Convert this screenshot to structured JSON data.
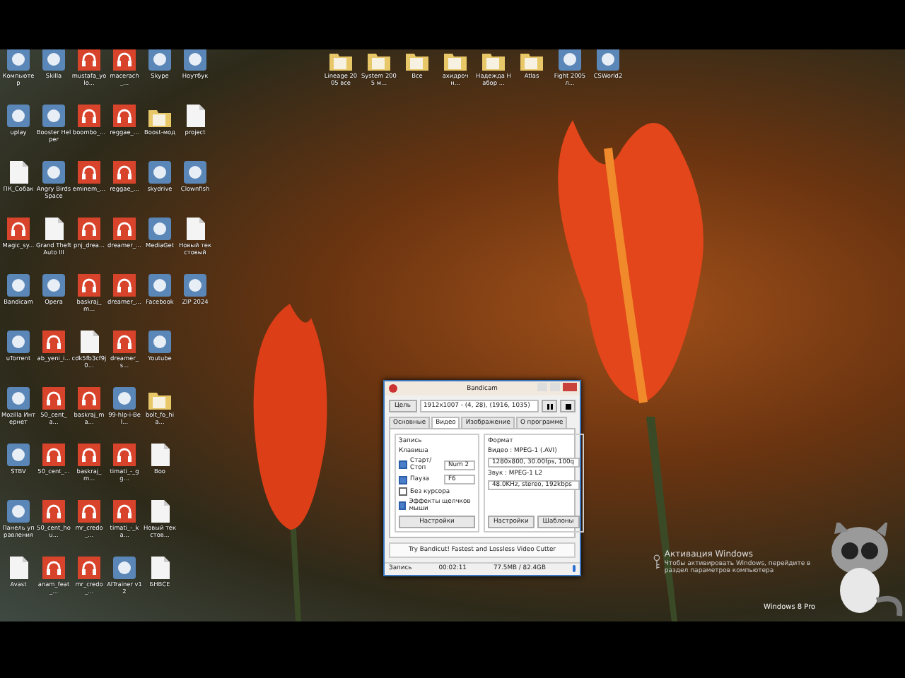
{
  "desktop_columns": [
    {
      "icons": [
        {
          "label": "Компьютер",
          "kind": "app"
        },
        {
          "label": "uplay",
          "kind": "app"
        },
        {
          "label": "ПК_Собак",
          "kind": "file"
        },
        {
          "label": "Magic_sy...",
          "kind": "audio"
        },
        {
          "label": "Bandicam",
          "kind": "app"
        },
        {
          "label": "uTorrent",
          "kind": "app"
        },
        {
          "label": "Mozilla Интернет",
          "kind": "app"
        },
        {
          "label": "STBV",
          "kind": "app"
        },
        {
          "label": "Панель управления",
          "kind": "app"
        },
        {
          "label": "Avast",
          "kind": "file"
        }
      ]
    },
    {
      "icons": [
        {
          "label": "Skilla",
          "kind": "app"
        },
        {
          "label": "Booster Helper",
          "kind": "app"
        },
        {
          "label": "Angry Birds Space",
          "kind": "app"
        },
        {
          "label": "Grand Theft Auto III",
          "kind": "file"
        },
        {
          "label": "Opera",
          "kind": "app"
        },
        {
          "label": "ab_yeni_i...",
          "kind": "audio"
        },
        {
          "label": "50_cent_a...",
          "kind": "audio"
        },
        {
          "label": "50_cent_...",
          "kind": "audio"
        },
        {
          "label": "50_cent_hou...",
          "kind": "audio"
        },
        {
          "label": "anam_feat_...",
          "kind": "audio"
        }
      ]
    },
    {
      "icons": [
        {
          "label": "mustafa_yolo...",
          "kind": "audio"
        },
        {
          "label": "boombo_...",
          "kind": "audio"
        },
        {
          "label": "eminem_...",
          "kind": "audio"
        },
        {
          "label": "pnj_drea...",
          "kind": "audio"
        },
        {
          "label": "baskraj_m...",
          "kind": "audio"
        },
        {
          "label": "cdk5fb3cf9j0...",
          "kind": "file"
        },
        {
          "label": "baskraj_ma...",
          "kind": "audio"
        },
        {
          "label": "baskraj_m...",
          "kind": "audio"
        },
        {
          "label": "mr_credo_...",
          "kind": "audio"
        },
        {
          "label": "mr_credo_...",
          "kind": "audio"
        }
      ]
    },
    {
      "icons": [
        {
          "label": "macerach_...",
          "kind": "audio"
        },
        {
          "label": "reggae_...",
          "kind": "audio"
        },
        {
          "label": "reggae_...",
          "kind": "audio"
        },
        {
          "label": "dreamer_...",
          "kind": "audio"
        },
        {
          "label": "dreamer_...",
          "kind": "audio"
        },
        {
          "label": "dreamer_s...",
          "kind": "audio"
        },
        {
          "label": "99-hlp-i-Bel...",
          "kind": "app"
        },
        {
          "label": "timati_-_gg...",
          "kind": "audio"
        },
        {
          "label": "timati_-_ka...",
          "kind": "audio"
        },
        {
          "label": "AlTrainer v12",
          "kind": "app"
        }
      ]
    },
    {
      "icons": [
        {
          "label": "Skype",
          "kind": "app"
        },
        {
          "label": "Boost-мод",
          "kind": "folder"
        },
        {
          "label": "skydrive",
          "kind": "app"
        },
        {
          "label": "MediaGet",
          "kind": "app"
        },
        {
          "label": "Facebook",
          "kind": "app"
        },
        {
          "label": "Youtube",
          "kind": "app"
        },
        {
          "label": "bolt_fo_hia...",
          "kind": "folder"
        },
        {
          "label": "Boo",
          "kind": "file"
        },
        {
          "label": "Новый текстов...",
          "kind": "file"
        },
        {
          "label": "БНВСЕ",
          "kind": "file"
        }
      ]
    },
    {
      "icons": [
        {
          "label": "Ноутбук",
          "kind": "app"
        },
        {
          "label": "project",
          "kind": "file"
        },
        {
          "label": "Clownfish",
          "kind": "app"
        },
        {
          "label": "Новый текстовый",
          "kind": "file"
        },
        {
          "label": "ZIP 2024",
          "kind": "app"
        }
      ]
    }
  ],
  "top_icons": [
    {
      "label": "Lineage 2005 все",
      "kind": "folder"
    },
    {
      "label": "System 2005 м...",
      "kind": "folder"
    },
    {
      "label": "Все",
      "kind": "folder"
    },
    {
      "label": "ахидрочн...",
      "kind": "folder"
    },
    {
      "label": "Надежда Набор ...",
      "kind": "folder"
    },
    {
      "label": "Atlas",
      "kind": "folder"
    },
    {
      "label": "Fight 2005 л...",
      "kind": "app"
    },
    {
      "label": "CSWorld2",
      "kind": "app"
    }
  ],
  "bandicam": {
    "title": "Bandicam",
    "target_button": "Цель",
    "target_field": "1912x1007 - (4, 28), (1916, 1035)",
    "tabs": [
      {
        "label": "Основные",
        "selected": false
      },
      {
        "label": "Видео",
        "selected": true
      },
      {
        "label": "Изображение",
        "selected": false
      },
      {
        "label": "О программе",
        "selected": false
      }
    ],
    "record_group": {
      "title": "Запись",
      "hotkey_label": "Клавиша",
      "options": [
        {
          "label": "Старт/Стоп",
          "checked": true,
          "value": "Num 2"
        },
        {
          "label": "Пауза",
          "checked": true,
          "value": "F6"
        }
      ],
      "checks": [
        {
          "label": "Без курсора",
          "checked": false
        },
        {
          "label": "Эффекты щелчков мыши",
          "checked": true
        }
      ],
      "button": "Настройки"
    },
    "format_group": {
      "title": "Формат",
      "video_label": "Видео : MPEG-1 (.AVI)",
      "video_value": "1280x800, 30.00fps, 100q",
      "audio_label": "Звук : MPEG-1 L2",
      "audio_value": "48.0KHz, stereo, 192kbps",
      "buttons": [
        "Настройки",
        "Шаблоны"
      ]
    },
    "banner": "Try Bandicut! Fastest and Lossless Video Cutter",
    "status": {
      "state": "Запись",
      "time": "00:02:11",
      "size": "77.5MB / 82.4GB"
    }
  },
  "activation": {
    "title": "Активация Windows",
    "text": "Чтобы активировать Windows, перейдите в раздел параметров компьютера",
    "edition": "Windows 8 Pro"
  }
}
